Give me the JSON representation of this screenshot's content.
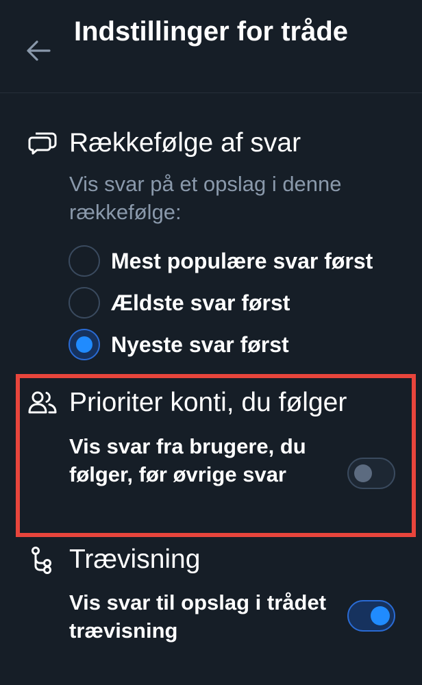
{
  "header": {
    "title": "Indstillinger for tråde",
    "back_icon": "arrow-left-icon"
  },
  "sort_section": {
    "icon": "speech-bubbles-icon",
    "title": "Rækkefølge af svar",
    "description": "Vis svar på et opslag i denne rækkefølge:",
    "options": [
      {
        "label": "Mest populære svar først",
        "selected": false
      },
      {
        "label": "Ældste svar først",
        "selected": false
      },
      {
        "label": "Nyeste svar først",
        "selected": true
      }
    ]
  },
  "prioritize_section": {
    "icon": "people-icon",
    "title": "Prioriter konti, du følger",
    "description": "Vis svar fra brugere, du følger, før øvrige svar",
    "toggle_on": false,
    "highlight_color": "#e8453c"
  },
  "tree_section": {
    "icon": "tree-view-icon",
    "title": "Trævisning",
    "description": "Vis svar til opslag i trådet trævisning",
    "toggle_on": true
  },
  "colors": {
    "background": "#161e27",
    "accent": "#208bfe",
    "muted_text": "#8a99ab"
  }
}
